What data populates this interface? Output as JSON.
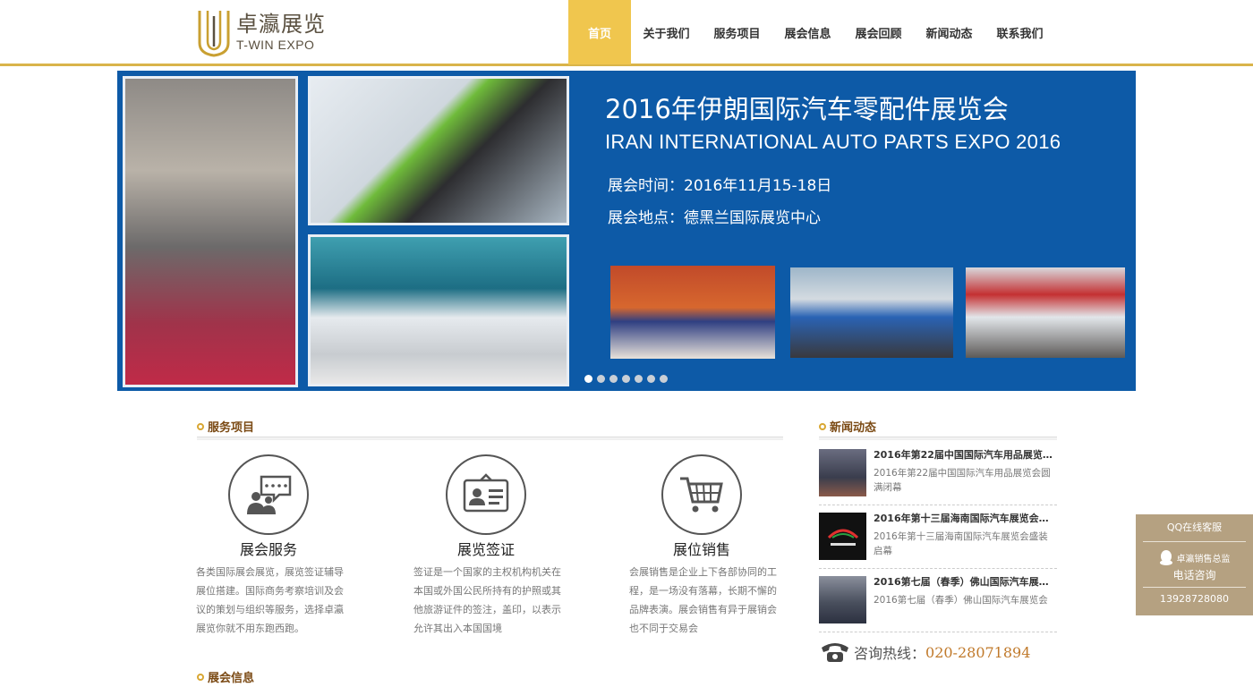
{
  "header": {
    "logo_cn": "卓瀛展览",
    "logo_en": "T-WIN EXPO",
    "nav": [
      {
        "label": "首页",
        "active": true
      },
      {
        "label": "关于我们"
      },
      {
        "label": "服务项目"
      },
      {
        "label": "展会信息"
      },
      {
        "label": "展会回顾"
      },
      {
        "label": "新闻动态"
      },
      {
        "label": "联系我们"
      }
    ]
  },
  "banner": {
    "title": "2016年伊朗国际汽车零配件展览会",
    "subtitle": "IRAN INTERNATIONAL AUTO PARTS EXPO 2016",
    "time": "展会时间：2016年11月15-18日",
    "place": "展会地点：德黑兰国际展览中心",
    "dots_count": 7,
    "active_dot": 0
  },
  "services": {
    "heading": "服务项目",
    "items": [
      {
        "icon": "chat-people-icon",
        "title": "展会服务",
        "desc": "各类国际展会展览，展览签证辅导展位搭建。国际商务考察培训及会议的策划与组织等服务，选择卓瀛展览你就不用东跑西跑。"
      },
      {
        "icon": "id-card-icon",
        "title": "展览签证",
        "desc": "签证是一个国家的主权机构机关在本国或外国公民所持有的护照或其他旅游证件的签注，盖印，以表示允许其出入本国国境"
      },
      {
        "icon": "shopping-cart-icon",
        "title": "展位销售",
        "desc": "会展销售是企业上下各部协同的工程，是一场没有落幕，长期不懈的品牌表演。展会销售有异于展销会也不同于交易会"
      }
    ]
  },
  "expo_info": {
    "heading": "展会信息"
  },
  "news": {
    "heading": "新闻动态",
    "items": [
      {
        "title": "2016年第22届中国国际汽车用品展览会圆满闭幕",
        "title_short": "2016年第22届中国国际汽车用品展览…",
        "desc": "2016年第22届中国国际汽车用品展览会圆满闭幕",
        "thumb_color": "#4a4c5e"
      },
      {
        "title": "2016年第十三届海南国际汽车展览会",
        "title_short": "2016年第十三届海南国际汽车展览会…",
        "desc": "2016年第十三届海南国际汽车展览会盛装启幕",
        "thumb_color": "#111111"
      },
      {
        "title": "2016第七届（春季）佛山国际汽车展览会",
        "title_short": "2016第七届（春季）佛山国际汽车展…",
        "desc": "2016第七届（春季）佛山国际汽车展览会",
        "thumb_color": "#5b6170"
      }
    ],
    "hotline_label": "咨询热线：",
    "hotline_number": "020-28071894"
  },
  "qq_panel": {
    "title": "QQ在线客服",
    "agent": "卓瀛销售总监",
    "phone_label": "电话咨询",
    "phone": "13928728080"
  },
  "colors": {
    "accent": "#f0c64e",
    "banner_bg": "#0d5aa7",
    "heading": "#7b4a14",
    "qq_bg": "#b5a181"
  }
}
